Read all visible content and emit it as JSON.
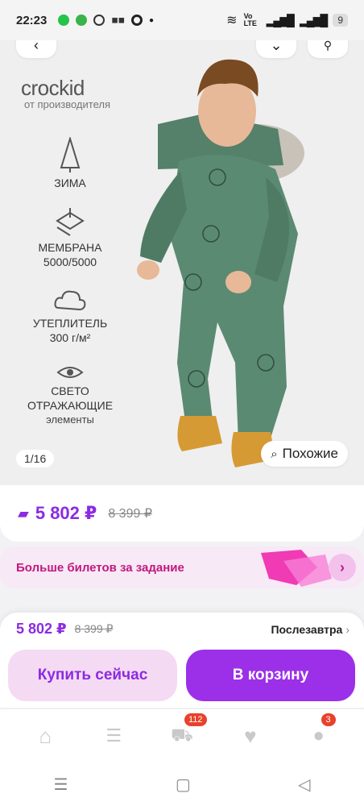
{
  "status": {
    "time": "22:23",
    "net": "Vo LTE",
    "battery": "9"
  },
  "hero": {
    "brand": "crockid",
    "brand_sub": "от производителя",
    "features": [
      {
        "icon": "snowflake-tree-icon",
        "label": "ЗИМА",
        "sub": ""
      },
      {
        "icon": "membrane-icon",
        "label": "МЕМБРАНА",
        "sub": "5000/5000"
      },
      {
        "icon": "cloud-icon",
        "label": "УТЕПЛИТЕЛЬ",
        "sub": "300 г/м²"
      },
      {
        "icon": "eye-icon",
        "label": "СВЕТО\nОТРАЖАЮЩИЕ",
        "sub": "элементы"
      }
    ],
    "counter": "1/16",
    "similar_label": "Похожие"
  },
  "price": {
    "current": "5 802 ₽",
    "old": "8 399 ₽"
  },
  "banner": {
    "text": "Больше билетов за задание"
  },
  "bottom": {
    "price": "5 802 ₽",
    "old": "8 399 ₽",
    "delivery": "Послезавтра",
    "buy_label": "Купить сейчас",
    "cart_label": "В корзину"
  },
  "tabs": {
    "cart_badge": "112",
    "profile_badge": "3"
  },
  "colors": {
    "accent": "#9b30e8",
    "price": "#8b2be2",
    "banner_text": "#c2187f"
  }
}
